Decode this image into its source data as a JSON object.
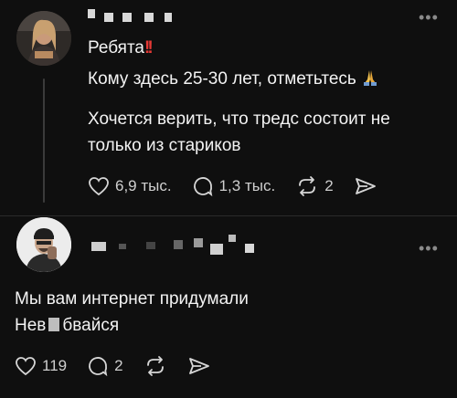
{
  "post1": {
    "line1": "Ребята",
    "line2": "Кому здесь 25-30 лет, отметьтесь",
    "line3": "Хочется верить, что тредс состоит не",
    "line4": "только из стариков",
    "likes": "6,9 тыс.",
    "replies": "1,3 тыс.",
    "reposts": "2"
  },
  "post2": {
    "line1": "Мы вам интернет придумали",
    "line2_start": "Нев",
    "line2_end": "бвайся",
    "likes": "119",
    "replies": "2"
  },
  "icons": [
    "more-icon",
    "heart-icon",
    "comment-icon",
    "repost-icon",
    "share-icon",
    "double-exclamation-icon",
    "praying-hands-icon"
  ]
}
